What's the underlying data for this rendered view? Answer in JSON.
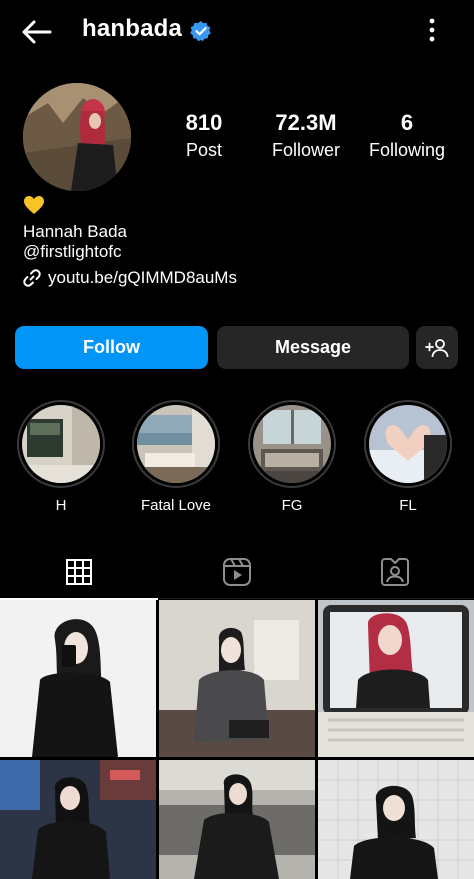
{
  "header": {
    "username": "hanbada",
    "back_icon": "arrow-left-icon",
    "verified_icon": "verified-badge-icon",
    "menu_icon": "more-vertical-icon"
  },
  "stats": {
    "posts_value": "810",
    "posts_label": "Post",
    "followers_value": "72.3M",
    "followers_label": "Follower",
    "following_value": "6",
    "following_label": "Following"
  },
  "bio": {
    "emoji": "💛",
    "name": "Hannah Bada",
    "handle": "@firstlightofc",
    "link": "youtu.be/gQIMMD8auMs"
  },
  "actions": {
    "follow_label": "Follow",
    "message_label": "Message",
    "add_user_icon": "add-person-icon"
  },
  "highlights": [
    {
      "label": "H"
    },
    {
      "label": "Fatal Love"
    },
    {
      "label": "FG"
    },
    {
      "label": "FL"
    }
  ],
  "tabs": [
    {
      "icon": "grid-icon",
      "active": true
    },
    {
      "icon": "reels-icon",
      "active": false
    },
    {
      "icon": "tagged-icon",
      "active": false
    }
  ],
  "colors": {
    "accent": "#0095f6",
    "background": "#000000",
    "button_dark": "#262626",
    "verified": "#3897f0"
  }
}
